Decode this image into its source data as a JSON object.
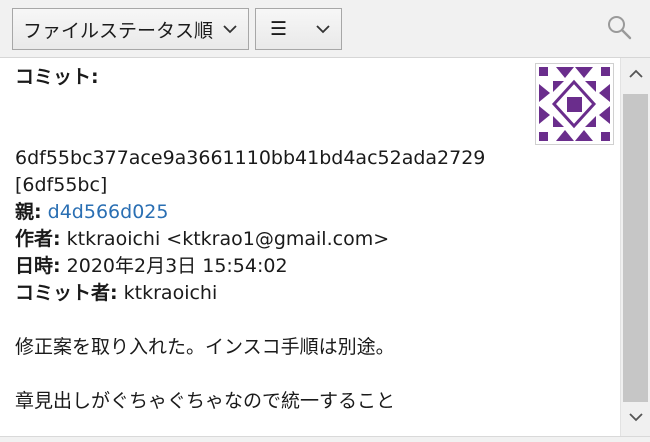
{
  "toolbar": {
    "sort_label": "ファイルステータス順",
    "view_label": "☰",
    "search_icon": "search-icon"
  },
  "commit": {
    "commit_label": "コミット:",
    "hash": "6df55bc377ace9a3661110bb41bd4ac52ada2729",
    "short_hash": "[6df55bc]",
    "parent_label": "親:",
    "parent_hash": "d4d566d025",
    "author_label": "作者:",
    "author_value": "ktkraoichi <ktkrao1@gmail.com>",
    "date_label": "日時:",
    "date_value": "2020年2月3日 15:54:02",
    "committer_label": "コミット者:",
    "committer_value": "ktkraoichi",
    "message_line1": "修正案を取り入れた。インスコ手順は別途。",
    "message_line2": "章見出しがぐちゃぐちゃなので統一すること"
  },
  "colors": {
    "link": "#2a6fb3",
    "avatar": "#6a2d8c",
    "toolbar_bg": "#f1f1f1"
  }
}
